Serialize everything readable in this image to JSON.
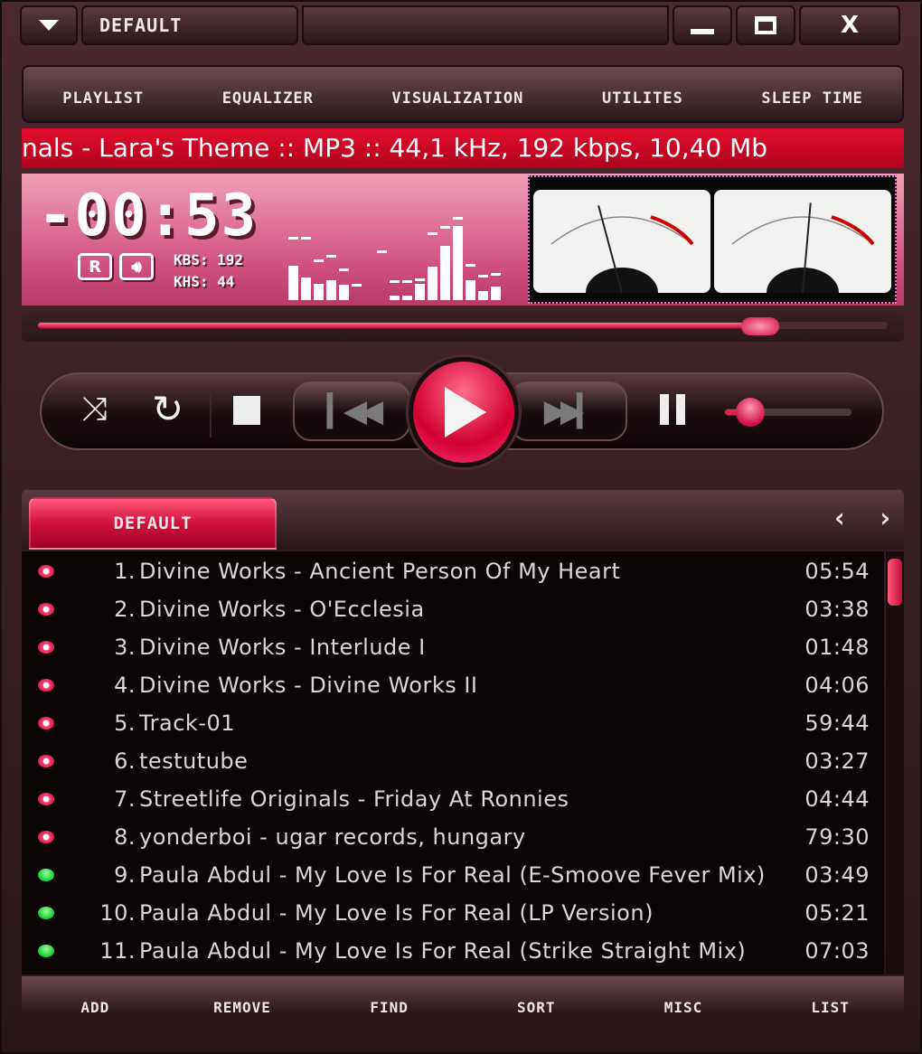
{
  "titlebar": {
    "menu_icon": "triangle-down-icon",
    "title": "DEFAULT",
    "minimize": "minimize-icon",
    "maximize": "maximize-icon",
    "close": "X"
  },
  "menu": [
    {
      "label": "PLAYLIST"
    },
    {
      "label": "EQUALIZER"
    },
    {
      "label": "VISUALIZATION"
    },
    {
      "label": "UTILITES"
    },
    {
      "label": "SLEEP TIME"
    }
  ],
  "ticker": {
    "text": "nals - Lara's Theme :: MP3 :: 44,1 kHz, 192 kbps, 10,40 Mb"
  },
  "display": {
    "time": "-00:53",
    "repeat_label": "R",
    "kbs": "KBS: 192",
    "khs": "KHS: 44",
    "spectrum": [
      0.38,
      0.25,
      0.18,
      0.22,
      0.17,
      0,
      0,
      0,
      0.05,
      0.05,
      0.18,
      0.37,
      0.6,
      0.82,
      0.22,
      0.1,
      0.15
    ],
    "spectrum_peaks": [
      0.7,
      0.7,
      0.45,
      0.5,
      0.35,
      0.18,
      0,
      0.55,
      0.22,
      0.22,
      0.24,
      0.75,
      0.82,
      0.92,
      0.4,
      0.28,
      0.3
    ],
    "vu_left": 0.35,
    "vu_right": 0.55
  },
  "seek": {
    "progress": 0.85
  },
  "transport": {
    "shuffle": "shuffle-icon",
    "repeat": "repeat-icon",
    "stop": "stop-icon",
    "prev": "previous-icon",
    "play": "play-icon",
    "next": "next-icon",
    "pause": "pause-icon",
    "volume": 0.2
  },
  "playlist": {
    "tab": "DEFAULT",
    "prev": "‹",
    "next": "›",
    "accent": "#e0103a",
    "items": [
      {
        "num": "1.",
        "title": "Divine Works - Ancient Person Of My Heart",
        "duration": "05:54",
        "status": "red"
      },
      {
        "num": "2.",
        "title": "Divine Works - O'Ecclesia",
        "duration": "03:38",
        "status": "red"
      },
      {
        "num": "3.",
        "title": "Divine Works - Interlude I",
        "duration": "01:48",
        "status": "red"
      },
      {
        "num": "4.",
        "title": "Divine Works - Divine Works II",
        "duration": "04:06",
        "status": "red"
      },
      {
        "num": "5.",
        "title": "Track-01",
        "duration": "59:44",
        "status": "red"
      },
      {
        "num": "6.",
        "title": "testutube",
        "duration": "03:27",
        "status": "red"
      },
      {
        "num": "7.",
        "title": "Streetlife Originals - Friday At Ronnies",
        "duration": "04:44",
        "status": "red"
      },
      {
        "num": "8.",
        "title": "yonderboi - ugar records, hungary",
        "duration": "79:30",
        "status": "red"
      },
      {
        "num": "9.",
        "title": "Paula Abdul - My Love Is For Real (E-Smoove Fever Mix)",
        "duration": "03:49",
        "status": "green"
      },
      {
        "num": "10.",
        "title": "Paula Abdul - My Love Is For Real (LP Version)",
        "duration": "05:21",
        "status": "green"
      },
      {
        "num": "11.",
        "title": "Paula Abdul - My Love Is For Real (Strike Straight Mix)",
        "duration": "07:03",
        "status": "green"
      }
    ]
  },
  "bottom": [
    {
      "label": "ADD"
    },
    {
      "label": "REMOVE"
    },
    {
      "label": "FIND"
    },
    {
      "label": "SORT"
    },
    {
      "label": "MISC"
    },
    {
      "label": "LIST"
    }
  ]
}
